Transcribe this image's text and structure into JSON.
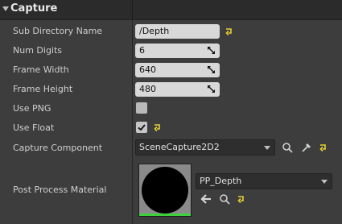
{
  "section": {
    "title": "Capture"
  },
  "rows": {
    "sub_directory": {
      "label": "Sub Directory Name",
      "value": "/Depth"
    },
    "num_digits": {
      "label": "Num Digits",
      "value": "6"
    },
    "frame_width": {
      "label": "Frame Width",
      "value": "640"
    },
    "frame_height": {
      "label": "Frame Height",
      "value": "480"
    },
    "use_png": {
      "label": "Use PNG",
      "checked": false
    },
    "use_float": {
      "label": "Use Float",
      "checked": true
    },
    "capture_component": {
      "label": "Capture Component",
      "value": "SceneCapture2D2"
    },
    "post_process_material": {
      "label": "Post Process Material",
      "value": "PP_Depth"
    }
  },
  "colors": {
    "reset_arrow": "#e6d033",
    "thumbnail_bar": "#3ed13e"
  },
  "icons": [
    "reset-to-default-icon",
    "drag-resize-icon",
    "search-icon",
    "eyedropper-icon",
    "use-selected-arrow-icon",
    "dropdown-chevron-icon"
  ]
}
